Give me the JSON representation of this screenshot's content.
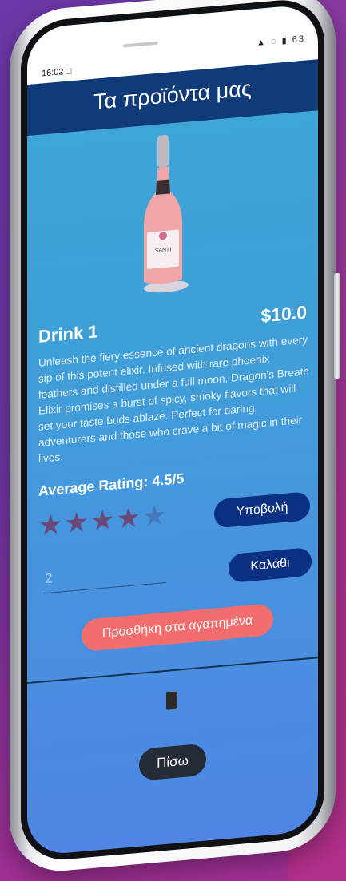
{
  "status_bar": {
    "time": "16:02",
    "battery": "63"
  },
  "app_bar": {
    "title": "Τα προϊόντα μας"
  },
  "product": {
    "name": "Drink 1",
    "price": "$10.0",
    "description": "Unleash the fiery essence of ancient dragons with every sip of this potent elixir. Infused with rare phoenix feathers and distilled under a full moon, Dragon's Breath Elixir promises a burst of spicy, smoky flavors that will set your taste buds ablaze. Perfect for daring adventurers and those who crave a bit of magic in their lives.",
    "average_rating_label": "Average Rating: 4.5/5",
    "stars_filled": 4,
    "stars_total": 5,
    "bottle_label": "SANTI"
  },
  "actions": {
    "submit_label": "Υποβολή",
    "cart_label": "Καλάθι",
    "favorites_label": "Προσθήκη στα αγαπημένα",
    "back_label": "Πίσω"
  },
  "quantity": {
    "value": "2"
  },
  "colors": {
    "app_bar": "#103a78",
    "screen_top": "#3ea8d6",
    "screen_bottom": "#4f86e3",
    "button_navy": "#0d3182",
    "favorites_button": "#f26d6d",
    "back_button": "#242a36",
    "star_filled": "#6a4878",
    "star_empty": "#4577bb"
  },
  "icons": [
    "sim-icon",
    "signal-icon",
    "wifi-icon",
    "battery-icon",
    "star-icon",
    "bottle-image"
  ]
}
